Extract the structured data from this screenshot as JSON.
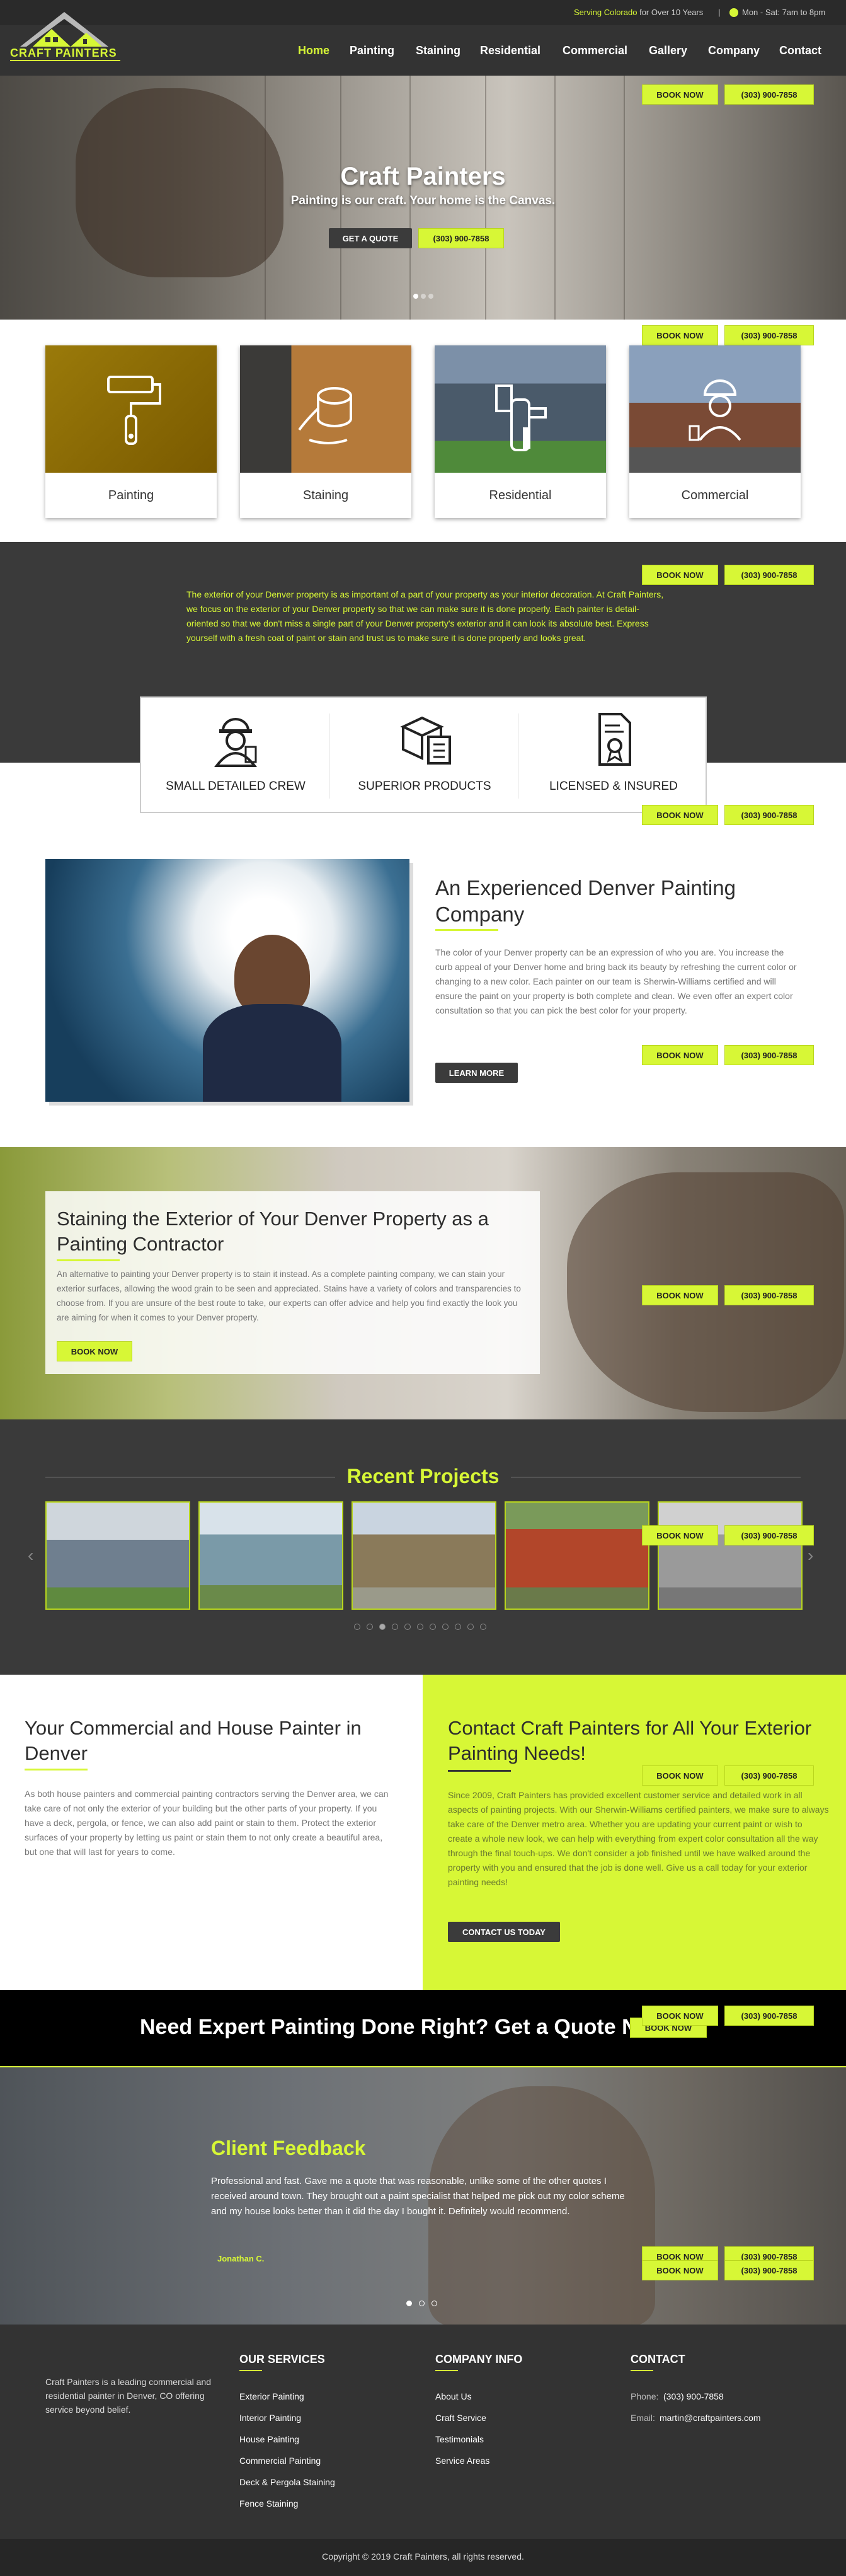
{
  "topbar": {
    "serving": "Serving Colorado",
    "serving_rest": "for Over 10 Years",
    "divider": "|",
    "hours": "Mon - Sat: 7am to 8pm"
  },
  "logo": {
    "text": "CRAFT PAINTERS"
  },
  "nav": {
    "items": [
      "Home",
      "Painting",
      "Staining",
      "Residential",
      "Commercial",
      "Gallery",
      "Company",
      "Contact"
    ]
  },
  "cta": {
    "book": "BOOK NOW",
    "phone": "(303) 900-7858"
  },
  "hero": {
    "title": "Craft Painters",
    "subtitle": "Painting is our craft. Your home is the Canvas.",
    "quote_btn": "GET A QUOTE",
    "phone_btn": "(303) 900-7858",
    "slides": 3,
    "active_slide": 1
  },
  "services": [
    {
      "label": "Painting",
      "icon": "paint-roller-icon"
    },
    {
      "label": "Staining",
      "icon": "stain-bucket-icon"
    },
    {
      "label": "Residential",
      "icon": "house-icon"
    },
    {
      "label": "Commercial",
      "icon": "worker-icon"
    }
  ],
  "intro": {
    "text": "The exterior of your Denver property is as important of a part of your property as your interior decoration. At Craft Painters, we focus on the exterior of your Denver property so that we can make sure it is done properly. Each painter is detail-oriented so that we don't miss a single part of your Denver property's exterior and it can look its absolute best. Express yourself with a fresh coat of paint or stain and trust us to make sure it is done properly and looks great."
  },
  "features": [
    {
      "label": "SMALL DETAILED CREW",
      "icon": "crew-icon"
    },
    {
      "label": "SUPERIOR PRODUCTS",
      "icon": "products-icon"
    },
    {
      "label": "LICENSED & INSURED",
      "icon": "certificate-icon"
    }
  ],
  "experienced": {
    "title": "An Experienced Denver Painting Company",
    "text": "The color of your Denver property can be an expression of who you are. You increase the curb appeal of your Denver home and bring back its beauty by refreshing the current color or changing to a new color. Each painter on our team is Sherwin-Williams certified and will ensure the paint on your property is both complete and clean. We even offer an expert color consultation so that you can pick the best color for your property.",
    "button": "LEARN MORE"
  },
  "staining": {
    "title": "Staining the Exterior of Your Denver Property as a Painting Contractor",
    "text": "An alternative to painting your Denver property is to stain it instead. As a complete painting company, we can stain your exterior surfaces, allowing the wood grain to be seen and appreciated. Stains have a variety of colors and transparencies to choose from. If you are unsure of the best route to take, our experts can offer advice and help you find exactly the look you are aiming for when it comes to your Denver property.",
    "button": "BOOK NOW"
  },
  "projects": {
    "title": "Recent Projects",
    "dots": 11,
    "active_dot": 2,
    "colors": [
      "#6f7f8f",
      "#7a9aa8",
      "#8a7a5a",
      "#b2462a",
      "#9a9a9a"
    ]
  },
  "commercial": {
    "title": "Your Commercial and House Painter in Denver",
    "text": "As both house painters and commercial painting contractors serving the Denver area, we can take care of not only the exterior of your building but the other parts of your property. If you have a deck, pergola, or fence, we can also add paint or stain to them. Protect the exterior surfaces of your property by letting us paint or stain them to not only create a beautiful area, but one that will last for years to come."
  },
  "contact": {
    "title": "Contact Craft Painters for All Your Exterior Painting Needs!",
    "text": "Since 2009, Craft Painters has provided excellent customer service and detailed work in all aspects of painting projects. With our Sherwin-Williams certified painters, we make sure to always take care of the Denver metro area. Whether you are updating your current paint or wish to create a whole new look, we can help with everything from expert color consultation all the way through the final touch-ups. We don't consider a job finished until we have walked around the property with you and ensured that the job is done well. Give us a call today for your exterior painting needs!",
    "button": "CONTACT US TODAY"
  },
  "quote_band": {
    "text": "Need Expert Painting Done Right? Get a Quote Now!",
    "button": "BOOK NOW"
  },
  "feedback": {
    "title": "Client Feedback",
    "text": "Professional and fast. Gave me a quote that was reasonable, unlike some of the other quotes I received around town. They brought out a paint specialist that helped me pick out my color scheme and my house looks better than it did the day I bought it. Definitely would recommend.",
    "author": "Jonathan C.",
    "dots": 3,
    "active_dot": 0
  },
  "footer": {
    "about": "Craft Painters is a leading commercial and residential painter in Denver, CO offering service beyond belief.",
    "services_title": "OUR SERVICES",
    "services": [
      "Exterior Painting",
      "Interior Painting",
      "House Painting",
      "Commercial Painting",
      "Deck & Pergola Staining",
      "Fence Staining"
    ],
    "company_title": "COMPANY INFO",
    "company": [
      "About Us",
      "Craft Service",
      "Testimonials",
      "Service Areas"
    ],
    "contact_title": "CONTACT",
    "phone_label": "Phone:",
    "phone": "(303) 900-7858",
    "email_label": "Email:",
    "email": "martin@craftpainters.com",
    "copyright": "Copyright © 2019 Craft Painters, all rights reserved."
  },
  "colors": {
    "accent": "#d7f736",
    "dark": "#3a3a3a"
  }
}
